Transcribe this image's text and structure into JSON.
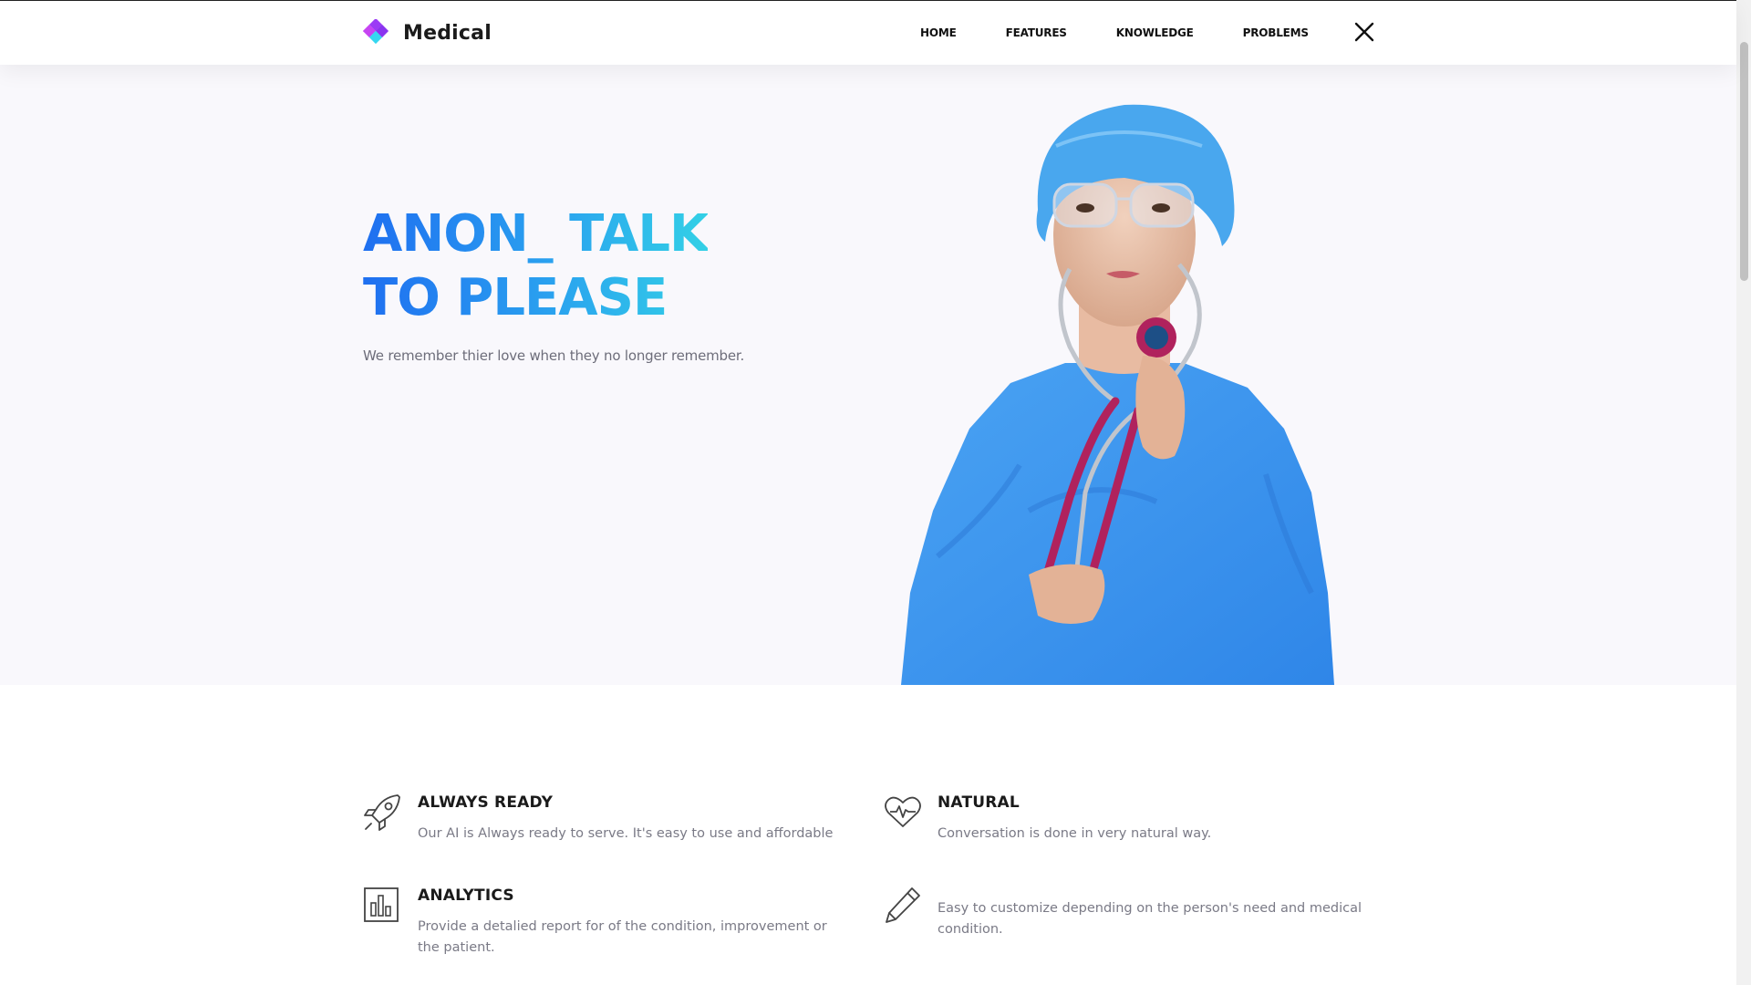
{
  "header": {
    "logo_text": "Medical",
    "logo_icon": "diamond-cluster-icon",
    "nav": [
      "HOME",
      "FEATURES",
      "KNOWLEDGE",
      "PROBLEMS"
    ],
    "close_icon": "close-icon"
  },
  "hero": {
    "title_line1": "ANON_ TALK",
    "title_line2": "TO PLEASE",
    "subtitle": "We remember thier love when they no longer remember.",
    "image": "nurse-with-stethoscope",
    "colors": {
      "gradient_start": "#1f6ff0",
      "gradient_end": "#33d0e6",
      "background": "#f9f8fc"
    }
  },
  "features": [
    {
      "icon": "rocket-icon",
      "title": "ALWAYS READY",
      "desc": "Our AI is Always ready to serve. It's easy to use and affordable"
    },
    {
      "icon": "heartbeat-icon",
      "title": "NATURAL",
      "desc": "Conversation is done in very natural way."
    },
    {
      "icon": "bar-chart-icon",
      "title": "ANALYTICS",
      "desc": "Provide a detalied report for of the condition, improvement or the patient."
    },
    {
      "icon": "pencil-icon",
      "title": "",
      "desc": "Easy to customize depending on the person's need and medical condition."
    }
  ]
}
